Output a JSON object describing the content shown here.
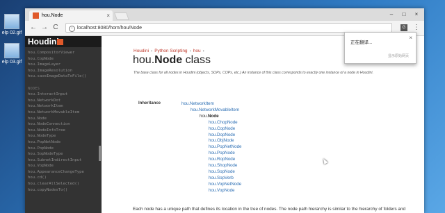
{
  "desktop": {
    "icons": [
      {
        "label": "elp 02.gif",
        "icon": "image-file-icon"
      },
      {
        "label": "elp 03.gif",
        "icon": "image-file-icon"
      }
    ]
  },
  "browser": {
    "tab_title": "hou.Node",
    "tab_close": "×",
    "url": "localhost:8080/hom/hou/Node",
    "win_min": "–",
    "win_max": "□",
    "win_close": "×",
    "back": "←",
    "forward": "→",
    "reload": "C",
    "menu": "⋮",
    "translate_icon": "G"
  },
  "sidebar": {
    "logo": "Houdini",
    "items": [
      "hou.CompositorViewer",
      "hou.CopNode",
      "hou.ImageLayer",
      "hou.ImageResolution",
      "hou.saveImageDataToFile()",
      "",
      "NODES",
      "hou.InteractInput",
      "hou.NetworkDot",
      "hou.NetworkItem",
      "hou.NetworkMovableItem",
      "hou.Node",
      "hou.NodeConnection",
      "hou.NodeInfoTree",
      "hou.NodeType",
      "hou.PopNetNode",
      "hou.PopNode",
      "hou.SopNodeType",
      "hou.SubnetIndirectInput",
      "hou.VopNode",
      "hou.AppearanceChangeType",
      "hou.cd()",
      "hou.clearAllSelected()",
      "hou.copyNodesTo()"
    ]
  },
  "content": {
    "breadcrumb": [
      "Houdini",
      "Python Scripting",
      "hou"
    ],
    "breadcrumb_sep": "›",
    "title_prefix": "hou.",
    "title_bold": "Node",
    "title_suffix": " class",
    "description": "The base class for all nodes in Houdini (objects, SOPs, COPs, etc.) An instance of this class corresponds to exactly one instance of a node in Houdini.",
    "inheritance_label": "Inheritance",
    "tree": [
      {
        "label": "hou.NetworkItem",
        "depth": 0,
        "current": false
      },
      {
        "label": "hou.NetworkMovableItem",
        "depth": 1,
        "current": false
      },
      {
        "label": "hou.Node",
        "depth": 2,
        "current": true
      },
      {
        "label": "hou.ChopNode",
        "depth": 3,
        "current": false
      },
      {
        "label": "hou.CopNode",
        "depth": 3,
        "current": false
      },
      {
        "label": "hou.DopNode",
        "depth": 3,
        "current": false
      },
      {
        "label": "hou.ObjNode",
        "depth": 3,
        "current": false
      },
      {
        "label": "hou.PopNetNode",
        "depth": 3,
        "current": false
      },
      {
        "label": "hou.PopNode",
        "depth": 3,
        "current": false
      },
      {
        "label": "hou.RopNode",
        "depth": 3,
        "current": false
      },
      {
        "label": "hou.ShopNode",
        "depth": 3,
        "current": false
      },
      {
        "label": "hou.SopNode",
        "depth": 3,
        "current": false
      },
      {
        "label": "hou.SopVerb",
        "depth": 3,
        "current": false
      },
      {
        "label": "hou.VopNetNode",
        "depth": 3,
        "current": false
      },
      {
        "label": "hou.VopNode",
        "depth": 3,
        "current": false
      }
    ],
    "paragraph": "Each node has a unique path that defines its location in the tree of nodes. The node path hierarchy is similar to the hierarchy of folders and files in a file system. Some nodes, called networks, may contain other nodes inside them, much like a file folder would, while other nodes"
  },
  "translate_popup": {
    "text": "正在翻译...",
    "close": "×",
    "link": "显示原始网页"
  }
}
